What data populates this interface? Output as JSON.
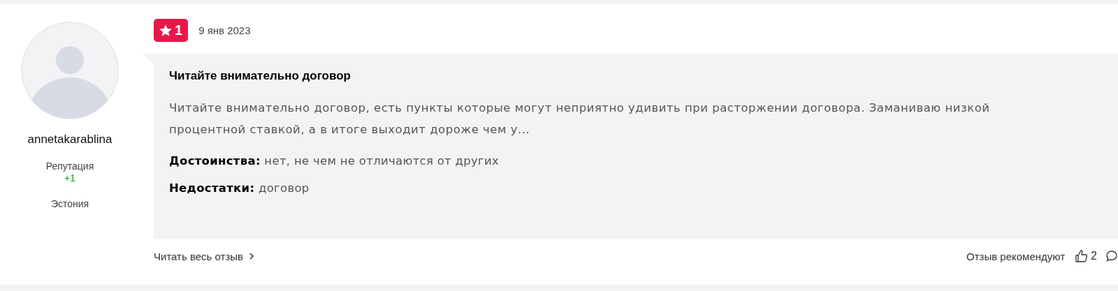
{
  "author": {
    "username": "annetakarablina",
    "reputation_label": "Репутация",
    "reputation_value": "+1",
    "location": "Эстония"
  },
  "review": {
    "rating": "1",
    "date": "9 янв 2023",
    "title": "Читайте внимательно договор",
    "text": "Читайте внимательно договор, есть пункты которые могут неприятно удивить при расторжении договора. Заманиваю низкой процентной ставкой, а в итоге выходит дороже чем у...",
    "details": [
      "**Достоинства:** нет, не чем не отличаются от других",
      "**Недостатки:** договор"
    ]
  },
  "footer": {
    "read_more": "Читать весь отзыв",
    "recommend_label": "Отзыв рекомендуют",
    "likes": "2"
  }
}
